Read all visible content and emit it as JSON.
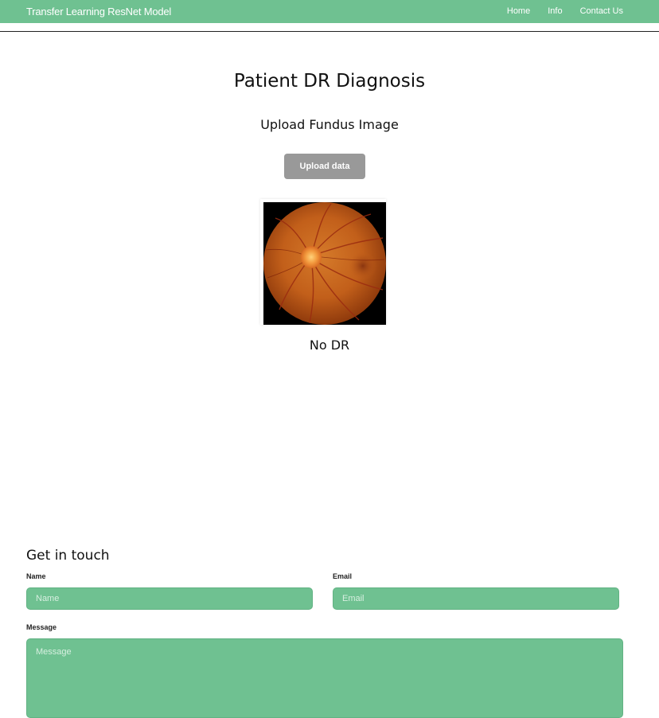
{
  "navbar": {
    "brand": "Transfer Learning ResNet Model",
    "links": [
      "Home",
      "Info",
      "Contact Us"
    ],
    "background": "#6fc191"
  },
  "main": {
    "title": "Patient DR Diagnosis",
    "subtitle": "Upload Fundus Image",
    "upload_button": "Upload data",
    "image_description": "retinal fundus photograph",
    "result": "No DR"
  },
  "contact": {
    "heading": "Get in touch",
    "name_label": "Name",
    "name_placeholder": "Name",
    "email_label": "Email",
    "email_placeholder": "Email",
    "message_label": "Message",
    "message_placeholder": "Message"
  },
  "colors": {
    "accent": "#6fc191",
    "button": "#999999"
  }
}
